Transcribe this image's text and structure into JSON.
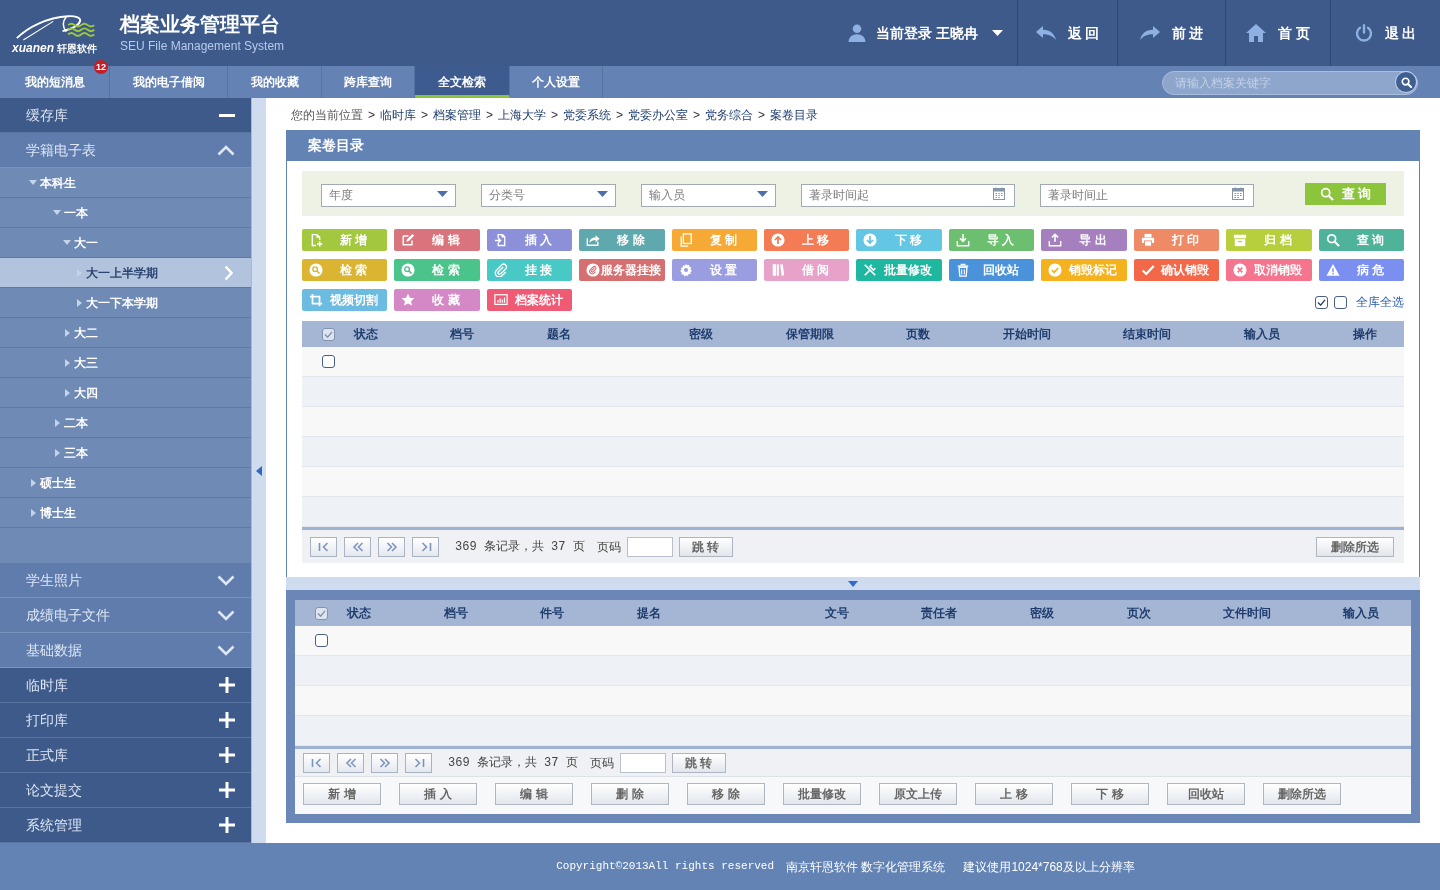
{
  "header": {
    "logo": {
      "wordmark": "xuanen",
      "tagline": "轩恩软件"
    },
    "title": "档案业务管理平台",
    "subtitle": "SEU File Management System",
    "user": {
      "text": "当前登录 王晓冉"
    },
    "actions": [
      {
        "label": "返 回"
      },
      {
        "label": "前 进"
      },
      {
        "label": "首 页"
      },
      {
        "label": "退 出"
      }
    ]
  },
  "nav": {
    "tabs": [
      {
        "label": "我的短消息",
        "selected": false,
        "badge": "12"
      },
      {
        "label": "我的电子借阅",
        "selected": false
      },
      {
        "label": "我的收藏",
        "selected": false
      },
      {
        "label": "跨库查询",
        "selected": false
      },
      {
        "label": "全文检索",
        "selected": true
      },
      {
        "label": "个人设置",
        "selected": false
      }
    ],
    "search": {
      "placeholder": "请输入档案关键字"
    }
  },
  "sidebar": {
    "sections": [
      {
        "label": "缓存库",
        "kind": "library",
        "expanded": true
      },
      {
        "label": "学籍电子表",
        "kind": "category",
        "expanded": true,
        "children": [
          {
            "label": "本科生",
            "expanded": true,
            "selected": false,
            "children": [
              {
                "label": "一本",
                "expanded": true,
                "selected": false,
                "children": [
                  {
                    "label": "大一",
                    "expanded": true,
                    "selected": false,
                    "children": [
                      {
                        "label": "大一上半学期",
                        "expanded": false,
                        "selected": true
                      },
                      {
                        "label": "大一下本学期",
                        "expanded": false,
                        "selected": false
                      }
                    ]
                  },
                  {
                    "label": "大二",
                    "expanded": false,
                    "selected": false
                  },
                  {
                    "label": "大三",
                    "expanded": false,
                    "selected": false
                  },
                  {
                    "label": "大四",
                    "expanded": false,
                    "selected": false
                  }
                ]
              },
              {
                "label": "二本",
                "expanded": false,
                "selected": false
              },
              {
                "label": "三本",
                "expanded": false,
                "selected": false
              }
            ]
          },
          {
            "label": "硕士生",
            "expanded": false,
            "selected": false
          },
          {
            "label": "博士生",
            "expanded": false,
            "selected": false
          }
        ]
      },
      {
        "label": "学生照片",
        "kind": "category",
        "expanded": false
      },
      {
        "label": "成绩电子文件",
        "kind": "category",
        "expanded": false
      },
      {
        "label": "基础数据",
        "kind": "category",
        "expanded": false
      },
      {
        "label": "临时库",
        "kind": "library",
        "expanded": false
      },
      {
        "label": "打印库",
        "kind": "library",
        "expanded": false
      },
      {
        "label": "正式库",
        "kind": "library",
        "expanded": false
      },
      {
        "label": "论文提交",
        "kind": "library",
        "expanded": false
      },
      {
        "label": "系统管理",
        "kind": "library",
        "expanded": false
      }
    ]
  },
  "breadcrumb": {
    "label": "您的当前位置",
    "items": [
      {
        "separator": ">",
        "text": "临时库"
      },
      {
        "separator": ">",
        "text": "档案管理"
      },
      {
        "separator": ">",
        "text": "上海大学"
      },
      {
        "separator": ">",
        "text": "党委系统"
      },
      {
        "separator": ">",
        "text": "党委办公室"
      },
      {
        "separator": ">",
        "text": "党务综合"
      },
      {
        "separator": ">",
        "text": "案卷目录"
      }
    ]
  },
  "records_panel": {
    "title": "案卷目录",
    "filters": [
      {
        "kind": "select",
        "placeholder": "年度"
      },
      {
        "kind": "select",
        "placeholder": "分类号"
      },
      {
        "kind": "select",
        "placeholder": "输入员"
      },
      {
        "kind": "date",
        "placeholder": "著录时间起"
      },
      {
        "kind": "date",
        "placeholder": "著录时间止"
      }
    ],
    "query_button": "查 询",
    "toolbar": [
      {
        "label": "新 增",
        "color": "#a3c83f"
      },
      {
        "label": "编 辑",
        "color": "#d9737c"
      },
      {
        "label": "插 入",
        "color": "#8c90d8"
      },
      {
        "label": "移 除",
        "color": "#5fa8ae"
      },
      {
        "label": "复 制",
        "color": "#f6a935"
      },
      {
        "label": "上 移",
        "color": "#f47c55"
      },
      {
        "label": "下 移",
        "color": "#63c6e2"
      },
      {
        "label": "导 入",
        "color": "#6cbf6e"
      },
      {
        "label": "导 出",
        "color": "#a680be"
      },
      {
        "label": "打 印",
        "color": "#ee8a66"
      },
      {
        "label": "归 档",
        "color": "#b7cf3c"
      },
      {
        "label": "查 询",
        "color": "#4fb39b"
      },
      {
        "label": "检 索",
        "color": "#dbb532"
      },
      {
        "label": "检 索",
        "color": "#4bc48b"
      },
      {
        "label": "挂 接",
        "color": "#48c9c5"
      },
      {
        "label": "服务器挂接",
        "color": "#d66f6f"
      },
      {
        "label": "设 置",
        "color": "#9a9ee0"
      },
      {
        "label": "借 阅",
        "color": "#e6a2c9"
      },
      {
        "label": "批量修改",
        "color": "#20b7a0"
      },
      {
        "label": "回收站",
        "color": "#4a93da"
      },
      {
        "label": "销毁标记",
        "color": "#f5b21f"
      },
      {
        "label": "确认销毁",
        "color": "#f4684a"
      },
      {
        "label": "取消销毁",
        "color": "#f4758d"
      },
      {
        "label": "病 危",
        "color": "#7b8ff0"
      },
      {
        "label": "视频切割",
        "color": "#6cbbe0"
      },
      {
        "label": "收 藏",
        "color": "#d588c6"
      },
      {
        "label": "档案统计",
        "color": "#ef5a74"
      }
    ],
    "select_all": {
      "boxes": [
        {
          "checked": true
        },
        {
          "checked": false
        }
      ],
      "label": "全库全选"
    },
    "table": {
      "header_checked": true,
      "columns": [
        "状态",
        "档号",
        "题名",
        "密级",
        "保管期限",
        "页数",
        "开始时间",
        "结束时间",
        "输入员",
        "操作"
      ],
      "rows": [
        {
          "checked": false
        }
      ]
    },
    "pager": {
      "summary": "369 条记录，共 37 页",
      "page_label": "页码",
      "jump": "跳 转",
      "delete_selected": "删除所选"
    }
  },
  "files_panel": {
    "table": {
      "header_checked": true,
      "columns": [
        "状态",
        "档号",
        "件号",
        "提名",
        "文号",
        "责任者",
        "密级",
        "页次",
        "文件时间",
        "输入员"
      ],
      "rows": [
        {
          "checked": false
        }
      ]
    },
    "pager": {
      "summary": "369 条记录，共 37 页",
      "page_label": "页码",
      "jump": "跳 转"
    },
    "actions": [
      {
        "label": "新 增"
      },
      {
        "label": "插 入"
      },
      {
        "label": "编 辑"
      },
      {
        "label": "删 除"
      },
      {
        "label": "移 除"
      },
      {
        "label": "批量修改"
      },
      {
        "label": "原文上传"
      },
      {
        "label": "上 移"
      },
      {
        "label": "下 移"
      },
      {
        "label": "回收站"
      },
      {
        "label": "删除所选"
      }
    ]
  },
  "footer": {
    "copyright": "Copyright©2013All rights reserved",
    "company": "南京轩恩软件 数字化管理系统",
    "note": "建议使用1024*768及以上分辨率"
  }
}
